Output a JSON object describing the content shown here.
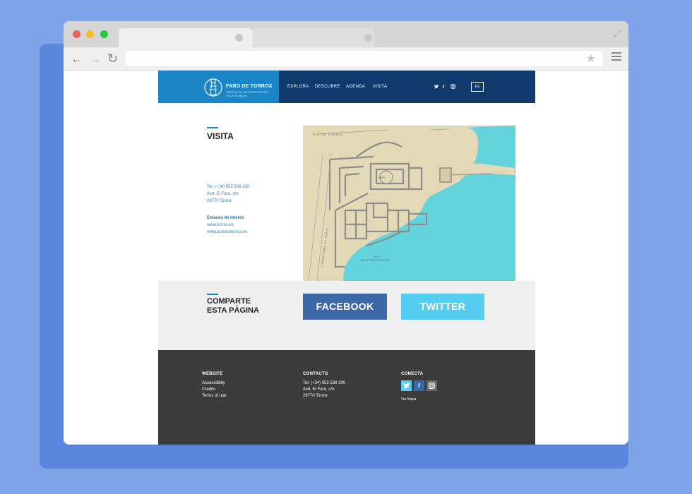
{
  "colors": {
    "background": "#7fa3e8",
    "brand_blue": "#1a86c7",
    "nav_dark": "#0f3a6b",
    "facebook": "#3c68a8",
    "twitter": "#55cdf0",
    "footer": "#3b3b3b",
    "map_sea": "#63d4dc",
    "map_land": "#e4d9b7"
  },
  "browser": {
    "url": "",
    "icons": [
      "back-arrow-icon",
      "forward-arrow-icon",
      "reload-icon",
      "star-icon",
      "hamburger-menu-icon",
      "expand-icon"
    ]
  },
  "header": {
    "brand_name": "FARO DE TORROX",
    "brand_sub": "CENTRO DE INTERPRETACIÓN VILLA ROMANA",
    "nav": [
      "EXPLORA",
      "DESCUBRE",
      "AGENDA",
      "VISITA"
    ],
    "social": [
      "twitter-icon",
      "facebook-icon",
      "instagram-icon"
    ],
    "lang": "ES"
  },
  "visita": {
    "title": "VISITA",
    "contact": [
      "Tel. (+34) 952 538 200",
      "Avd. El Faro, s/n.",
      "29770 Torrox"
    ],
    "links_heading": "Enlaces de interés",
    "links": [
      "www.torrox.es",
      "www.turismotorrox.es"
    ]
  },
  "map": {
    "labels": {
      "river": "RÍO DE TORROX",
      "faro": "FARO",
      "sea_1": "MAR",
      "sea_2": "MEDITERRÁNEO",
      "street": "CARRETERA EL FARO"
    }
  },
  "share": {
    "title_line1": "COMPARTE",
    "title_line2": "ESTA PÁGINA",
    "facebook": "FACEBOOK",
    "twitter": "TWITTER"
  },
  "footer": {
    "website": {
      "heading": "WEBSITE",
      "items": [
        "Accessibility",
        "Credits",
        "Terms of use"
      ]
    },
    "contacto": {
      "heading": "CONTACTO",
      "items": [
        "Tel. (+34) 952 538 200",
        "Avd. El Faro, s/n.",
        "29770 Torrox"
      ]
    },
    "conecta": {
      "heading": "CONECTA",
      "icons": [
        "twitter-icon",
        "facebook-icon",
        "instagram-icon"
      ],
      "map_link": "Ver Mapa"
    }
  }
}
